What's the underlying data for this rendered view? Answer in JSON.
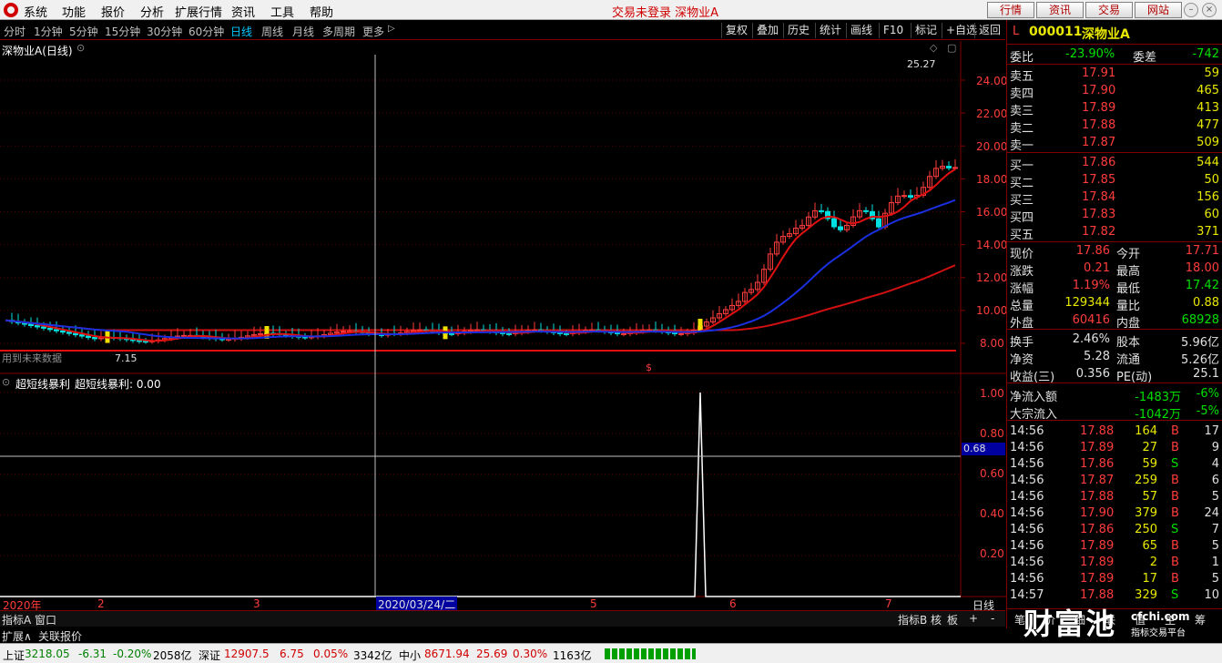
{
  "menu": {
    "items": [
      "系统",
      "功能",
      "报价",
      "分析",
      "扩展行情",
      "资讯",
      "工具",
      "帮助"
    ],
    "center_text": "交易未登录  深物业A",
    "buttons": [
      "行情",
      "资讯",
      "交易",
      "网站"
    ]
  },
  "periods": [
    "分时",
    "1分钟",
    "5分钟",
    "15分钟",
    "30分钟",
    "60分钟",
    "日线",
    "周线",
    "月线",
    "多周期",
    "更多"
  ],
  "active_period": "日线",
  "tools": [
    "复权",
    "叠加",
    "历史",
    "统计",
    "画线",
    "F10",
    "标记",
    "+自选",
    "返回"
  ],
  "main_chart": {
    "title": "深物业A(日线)",
    "max_label": "25.27",
    "min_label": "7.15",
    "future_note": "用到未来数据",
    "y_ticks": [
      "24.00",
      "22.00",
      "20.00",
      "18.00",
      "16.00",
      "14.00",
      "12.00",
      "10.00",
      "8.00"
    ],
    "marker": "$"
  },
  "indicator": {
    "title": "超短线暴利",
    "value_label": "超短线暴利: 0.00",
    "y_ticks": [
      "1.00",
      "0.80",
      "0.60",
      "0.40",
      "0.20"
    ],
    "cursor_value": "0.68"
  },
  "date_axis": {
    "labels": [
      "2020年",
      "2",
      "3",
      "2020/03/24/二",
      "5",
      "6",
      "7"
    ],
    "right": "日线"
  },
  "bottom_tabs": {
    "left": [
      "指标A",
      "窗口"
    ],
    "right": [
      "指标B",
      "核",
      "板",
      "+",
      "-"
    ],
    "second": [
      "扩展∧",
      "关联报价"
    ]
  },
  "quote": {
    "code_prefix": "L",
    "code": "000011",
    "name": "深物业A",
    "weibi_label": "委比",
    "weibi": "-23.90%",
    "weicha_label": "委差",
    "weicha": "-742",
    "asks": [
      {
        "label": "卖五",
        "price": "17.91",
        "vol": "59"
      },
      {
        "label": "卖四",
        "price": "17.90",
        "vol": "465"
      },
      {
        "label": "卖三",
        "price": "17.89",
        "vol": "413"
      },
      {
        "label": "卖二",
        "price": "17.88",
        "vol": "477"
      },
      {
        "label": "卖一",
        "price": "17.87",
        "vol": "509"
      }
    ],
    "bids": [
      {
        "label": "买一",
        "price": "17.86",
        "vol": "544"
      },
      {
        "label": "买二",
        "price": "17.85",
        "vol": "50"
      },
      {
        "label": "买三",
        "price": "17.84",
        "vol": "156"
      },
      {
        "label": "买四",
        "price": "17.83",
        "vol": "60"
      },
      {
        "label": "买五",
        "price": "17.82",
        "vol": "371"
      }
    ],
    "stats": [
      {
        "l1": "现价",
        "v1": "17.86",
        "l2": "今开",
        "v2": "17.71"
      },
      {
        "l1": "涨跌",
        "v1": "0.21",
        "l2": "最高",
        "v2": "18.00"
      },
      {
        "l1": "涨幅",
        "v1": "1.19%",
        "l2": "最低",
        "v2": "17.42"
      },
      {
        "l1": "总量",
        "v1": "129344",
        "l2": "量比",
        "v2": "0.88"
      },
      {
        "l1": "外盘",
        "v1": "60416",
        "l2": "内盘",
        "v2": "68928"
      }
    ],
    "stats2": [
      {
        "l1": "换手",
        "v1": "2.46%",
        "l2": "股本",
        "v2": "5.96亿"
      },
      {
        "l1": "净资",
        "v1": "5.28",
        "l2": "流通",
        "v2": "5.26亿"
      },
      {
        "l1": "收益(三)",
        "v1": "0.356",
        "l2": "PE(动)",
        "v2": "25.1"
      }
    ],
    "flows": [
      {
        "label": "净流入额",
        "value": "-1483万",
        "pct": "-6%"
      },
      {
        "label": "大宗流入",
        "value": "-1042万",
        "pct": "-5%"
      }
    ],
    "ticks": [
      {
        "time": "14:56",
        "price": "17.88",
        "vol": "164",
        "side": "B",
        "n": "17"
      },
      {
        "time": "14:56",
        "price": "17.89",
        "vol": "27",
        "side": "B",
        "n": "9"
      },
      {
        "time": "14:56",
        "price": "17.86",
        "vol": "59",
        "side": "S",
        "n": "4"
      },
      {
        "time": "14:56",
        "price": "17.87",
        "vol": "259",
        "side": "B",
        "n": "6"
      },
      {
        "time": "14:56",
        "price": "17.88",
        "vol": "57",
        "side": "B",
        "n": "5"
      },
      {
        "time": "14:56",
        "price": "17.90",
        "vol": "379",
        "side": "B",
        "n": "24"
      },
      {
        "time": "14:56",
        "price": "17.86",
        "vol": "250",
        "side": "S",
        "n": "7"
      },
      {
        "time": "14:56",
        "price": "17.89",
        "vol": "65",
        "side": "B",
        "n": "5"
      },
      {
        "time": "14:56",
        "price": "17.89",
        "vol": "2",
        "side": "B",
        "n": "1"
      },
      {
        "time": "14:56",
        "price": "17.89",
        "vol": "17",
        "side": "B",
        "n": "5"
      },
      {
        "time": "14:57",
        "price": "17.88",
        "vol": "329",
        "side": "S",
        "n": "10"
      }
    ],
    "bottom_tabs": [
      "笔",
      "价",
      "细",
      "联",
      "值",
      "主",
      "筹"
    ]
  },
  "watermark": {
    "main": "财富池",
    "site": "cfchi.com",
    "sub": "指标交易平台"
  },
  "status": {
    "sh_label": "上证",
    "sh_value": "3218.05",
    "sh_chg": "-6.31",
    "sh_pct": "-0.20%",
    "sh_amt": "2058亿",
    "sz_label": "深证",
    "sz_value": "12907.5",
    "sz_chg": "6.75",
    "sz_pct": "0.05%",
    "sz_amt": "3342亿",
    "zx_label": "中小",
    "zx_value": "8671.94",
    "zx_chg": "25.69",
    "zx_pct": "0.30%",
    "zx_amt": "1163亿"
  },
  "colors": {
    "up": "#ff3c3c",
    "down": "#00e0e0",
    "ma1": "#e01010",
    "ma2": "#1a2fe0",
    "ma3": "#d01010"
  }
}
